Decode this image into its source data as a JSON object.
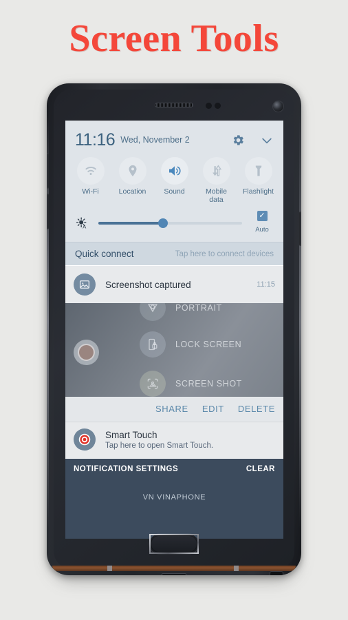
{
  "page": {
    "title": "Screen Tools",
    "title_color": "#f4473a",
    "background_color": "#e9e9e7"
  },
  "statusbar": {
    "time": "11:16",
    "date": "Wed, November 2",
    "gear_icon": "gear-icon",
    "chevron_icon": "chevron-down-icon"
  },
  "quick_toggles": [
    {
      "label": "Wi-Fi",
      "icon": "wifi-icon",
      "active": false
    },
    {
      "label": "Location",
      "icon": "location-pin-icon",
      "active": false
    },
    {
      "label": "Sound",
      "icon": "speaker-icon",
      "active": true
    },
    {
      "label": "Mobile\ndata",
      "icon": "data-arrows-icon",
      "active": false
    },
    {
      "label": "Flashlight",
      "icon": "flashlight-icon",
      "active": false
    }
  ],
  "brightness": {
    "icon": "brightness-auto-icon",
    "value_percent": 45,
    "auto_label": "Auto",
    "auto_checked": true,
    "fill_color": "#4a7296",
    "knob_color": "#5186b5"
  },
  "quick_connect": {
    "title": "Quick connect",
    "hint": "Tap here to connect devices"
  },
  "notification_screenshot": {
    "icon": "image-icon",
    "title": "Screenshot captured",
    "time": "11:15"
  },
  "preview": {
    "float_button": "floating-touch-ball",
    "rows": [
      {
        "label": "PORTRAIT",
        "icon": "portrait-icon"
      },
      {
        "label": "LOCK SCREEN",
        "icon": "lock-screen-icon"
      },
      {
        "label": "SCREEN SHOT",
        "icon": "screenshot-icon"
      }
    ]
  },
  "actions": [
    {
      "label": "SHARE"
    },
    {
      "label": "EDIT"
    },
    {
      "label": "DELETE"
    }
  ],
  "notification_smart_touch": {
    "icon": "target-icon",
    "title": "Smart Touch",
    "subtitle": "Tap here to open Smart Touch."
  },
  "bottom_bar": {
    "settings_label": "NOTIFICATION SETTINGS",
    "clear_label": "CLEAR",
    "carrier": "VN VINAPHONE",
    "background_color": "#3c4b5d"
  }
}
